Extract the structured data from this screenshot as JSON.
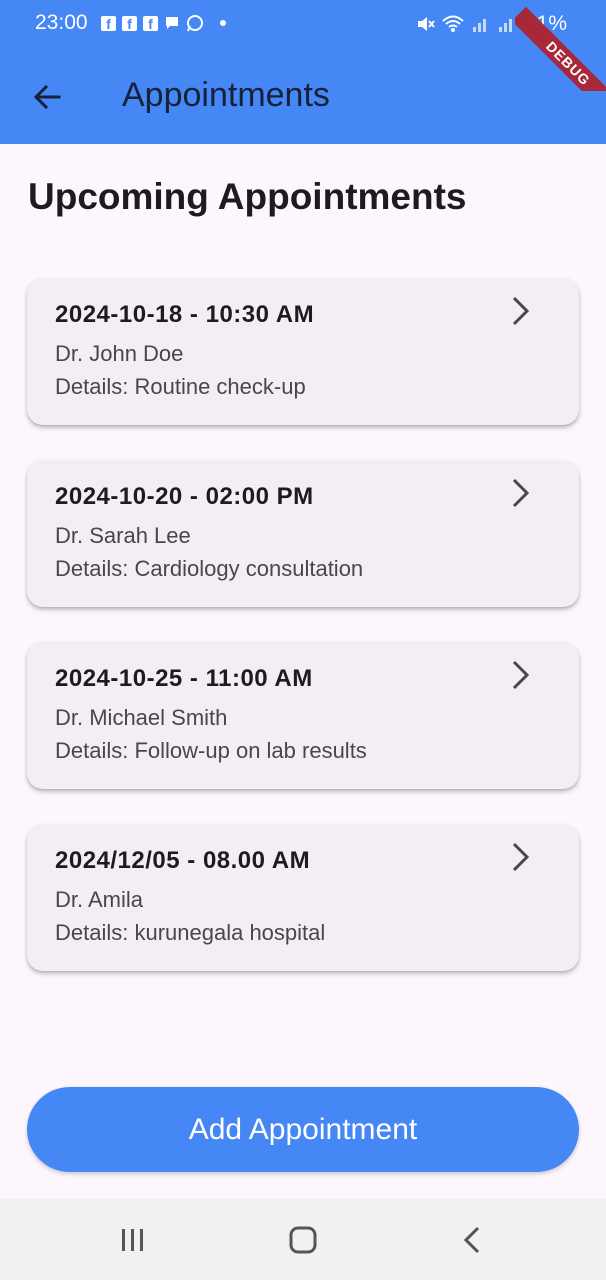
{
  "status_bar": {
    "time": "23:00",
    "battery": "31%",
    "ribbon": "DEBUG"
  },
  "app_bar": {
    "title": "Appointments"
  },
  "section_title": "Upcoming Appointments",
  "appointments": [
    {
      "datetime": "2024-10-18 - 10:30 AM",
      "doctor": "Dr. John Doe",
      "details": "Details: Routine check-up"
    },
    {
      "datetime": "2024-10-20 - 02:00 PM",
      "doctor": "Dr. Sarah Lee",
      "details": "Details: Cardiology consultation"
    },
    {
      "datetime": "2024-10-25 - 11:00 AM",
      "doctor": "Dr. Michael Smith",
      "details": "Details: Follow-up on lab results"
    },
    {
      "datetime": "2024/12/05 - 08.00 AM",
      "doctor": "Dr. Amila",
      "details": "Details: kurunegala hospital"
    }
  ],
  "add_button_label": "Add Appointment",
  "colors": {
    "primary": "#4487f5",
    "background": "#fdf7fd",
    "card": "#f4eef4",
    "debug": "#a8283a"
  },
  "icons": {
    "back": "arrow-back-icon",
    "chevron": "chevron-right-icon",
    "nav_recents": "recents-icon",
    "nav_home": "home-icon",
    "nav_back": "nav-back-icon"
  }
}
